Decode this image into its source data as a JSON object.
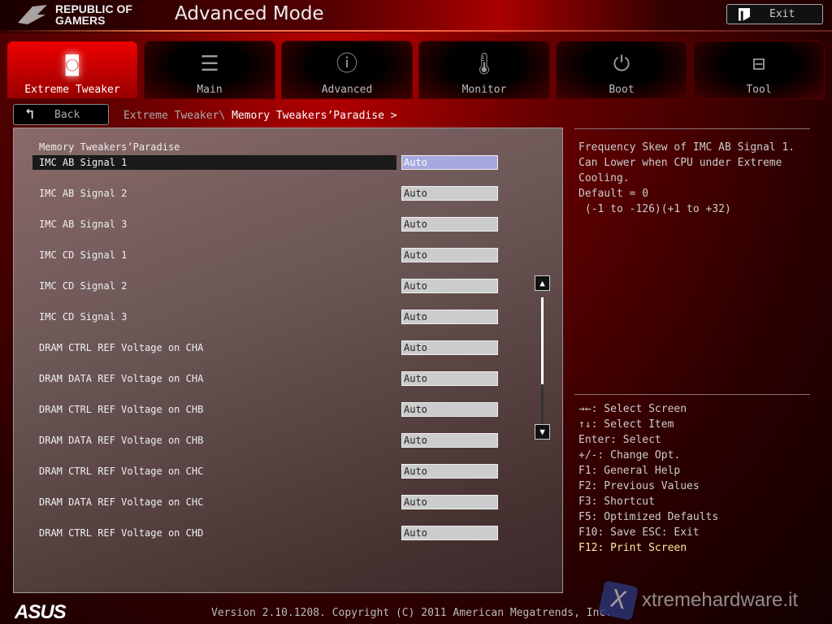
{
  "header": {
    "logo": "REPUBLIC OF GAMERS",
    "logo_line1": "REPUBLIC OF",
    "logo_line2": "GAMERS",
    "title": "Advanced Mode",
    "exit_label": "Exit"
  },
  "tabs": [
    {
      "label": "Extreme Tweaker",
      "icon": "tweaker-icon",
      "active": true
    },
    {
      "label": "Main",
      "icon": "list-icon"
    },
    {
      "label": "Advanced",
      "icon": "advanced-info-icon"
    },
    {
      "label": "Monitor",
      "icon": "thermometer-icon"
    },
    {
      "label": "Boot",
      "icon": "power-icon"
    },
    {
      "label": "Tool",
      "icon": "toolbox-icon"
    }
  ],
  "nav": {
    "back_label": "Back",
    "crumb_parent": "Extreme Tweaker\\",
    "crumb_current": "Memory Tweakers’Paradise >"
  },
  "panel": {
    "section": "Memory Tweakers’Paradise",
    "items": [
      {
        "label": "IMC AB Signal 1",
        "value": "Auto"
      },
      {
        "label": "IMC AB Signal 2",
        "value": "Auto"
      },
      {
        "label": "IMC AB Signal 3",
        "value": "Auto"
      },
      {
        "label": "IMC CD Signal 1",
        "value": "Auto"
      },
      {
        "label": "IMC CD Signal 2",
        "value": "Auto"
      },
      {
        "label": "IMC CD Signal 3",
        "value": "Auto"
      },
      {
        "label": "DRAM CTRL REF Voltage on CHA",
        "value": "Auto"
      },
      {
        "label": "DRAM DATA REF Voltage on CHA",
        "value": "Auto"
      },
      {
        "label": "DRAM CTRL REF Voltage on CHB",
        "value": "Auto"
      },
      {
        "label": "DRAM DATA REF Voltage on CHB",
        "value": "Auto"
      },
      {
        "label": "DRAM CTRL REF Voltage on CHC",
        "value": "Auto"
      },
      {
        "label": "DRAM DATA REF Voltage on CHC",
        "value": "Auto"
      },
      {
        "label": "DRAM CTRL REF Voltage on CHD",
        "value": "Auto"
      }
    ],
    "selected_index": 0
  },
  "help": {
    "text": "Frequency Skew of IMC AB Signal 1.\nCan Lower when CPU under Extreme\nCooling.\nDefault = 0\n (-1 to -126)(+1 to +32)"
  },
  "keys": [
    "→←: Select Screen",
    "↑↓: Select Item",
    "Enter: Select",
    "+/-: Change Opt.",
    "F1: General Help",
    "F2: Previous Values",
    "F3: Shortcut",
    "F5: Optimized Defaults",
    "F10: Save  ESC: Exit",
    "F12: Print Screen"
  ],
  "footer": {
    "version": "Version 2.10.1208. Copyright (C) 2011 American Megatrends, Inc.",
    "brand": "ASUS",
    "watermark": "xtremehardware.it"
  }
}
